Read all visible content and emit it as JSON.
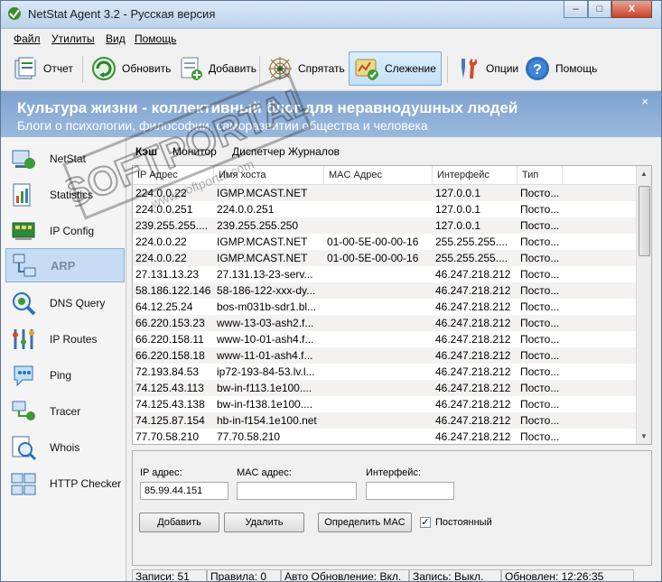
{
  "window": {
    "title": "NetStat Agent 3.2 - Русская версия",
    "controls": [
      "–",
      "□",
      "X"
    ]
  },
  "menu": [
    "Файл",
    "Утилиты",
    "Вид",
    "Помощь"
  ],
  "toolbar": {
    "report": "Отчет",
    "refresh": "Обновить",
    "add": "Добавить",
    "hide": "Спрятать",
    "monitor": "Слежение",
    "options": "Опции",
    "help": "Помощь"
  },
  "banner": {
    "title": "Культура жизни - коллективный блог для неравнодушных людей",
    "subtitle": "Блоги о психологии, философии, саморазвитии общества и человека",
    "close": "×"
  },
  "sidebar": [
    {
      "label": "NetStat"
    },
    {
      "label": "Statistics"
    },
    {
      "label": "IP Config"
    },
    {
      "label": "ARP",
      "active": true
    },
    {
      "label": "DNS Query"
    },
    {
      "label": "IP Routes"
    },
    {
      "label": "Ping"
    },
    {
      "label": "Tracer"
    },
    {
      "label": "Whois"
    },
    {
      "label": "HTTP Checker"
    }
  ],
  "tabs": [
    "Кэш",
    "Монитор",
    "Диспетчер Журналов"
  ],
  "table": {
    "columns": [
      "IP Адрес",
      "Имя хоста",
      "MAC Адрес",
      "Интерфейс",
      "Тип"
    ],
    "rows": [
      [
        "224.0.0.22",
        "IGMP.MCAST.NET",
        "",
        "127.0.0.1",
        "Посто..."
      ],
      [
        "224.0.0.251",
        "224.0.0.251",
        "",
        "127.0.0.1",
        "Посто..."
      ],
      [
        "239.255.255....",
        "239.255.255.250",
        "",
        "127.0.0.1",
        "Посто..."
      ],
      [
        "224.0.0.22",
        "IGMP.MCAST.NET",
        "01-00-5E-00-00-16",
        "255.255.255....",
        "Посто..."
      ],
      [
        "224.0.0.22",
        "IGMP.MCAST.NET",
        "01-00-5E-00-00-16",
        "255.255.255....",
        "Посто..."
      ],
      [
        "27.131.13.23",
        "27.131.13-23-serv...",
        "",
        "46.247.218.212",
        "Посто..."
      ],
      [
        "58.186.122.146",
        "58-186-122-xxx-dy...",
        "",
        "46.247.218.212",
        "Посто..."
      ],
      [
        "64.12.25.24",
        "bos-m031b-sdr1.bl...",
        "",
        "46.247.218.212",
        "Посто..."
      ],
      [
        "66.220.153.23",
        "www-13-03-ash2.f...",
        "",
        "46.247.218.212",
        "Посто..."
      ],
      [
        "66.220.158.11",
        "www-10-01-ash4.f...",
        "",
        "46.247.218.212",
        "Посто..."
      ],
      [
        "66.220.158.18",
        "www-11-01-ash4.f...",
        "",
        "46.247.218.212",
        "Посто..."
      ],
      [
        "72.193.84.53",
        "ip72-193-84-53.lv.l...",
        "",
        "46.247.218.212",
        "Посто..."
      ],
      [
        "74.125.43.113",
        "bw-in-f113.1e100....",
        "",
        "46.247.218.212",
        "Посто..."
      ],
      [
        "74.125.43.138",
        "bw-in-f138.1e100....",
        "",
        "46.247.218.212",
        "Посто..."
      ],
      [
        "74.125.87.154",
        "hb-in-f154.1e100.net",
        "",
        "46.247.218.212",
        "Посто..."
      ],
      [
        "77.70.58.210",
        "77.70.58.210",
        "",
        "46.247.218.212",
        "Посто..."
      ]
    ]
  },
  "form": {
    "ip_label": "IP адрес:",
    "ip_value": "85.99.44.151",
    "mac_label": "MAC адрес:",
    "mac_value": "",
    "iface_label": "Интерфейс:",
    "iface_value": "",
    "add_btn": "Добавить",
    "delete_btn": "Удалить",
    "resolve_btn": "Определить MAC",
    "permanent_label": "Постоянный",
    "permanent_checked": true,
    "check_mark": "✓"
  },
  "status": {
    "records": "Записи: 51",
    "rules": "Правила: 0",
    "auto_update": "Авто Обновление: Вкл.",
    "logging": "Запись: Выкл.",
    "updated": "Обновлен: 12:26:35"
  },
  "watermark": {
    "brand": "SOFTPORTAL",
    "url": "www.softportal.com",
    "tm": "TM"
  }
}
